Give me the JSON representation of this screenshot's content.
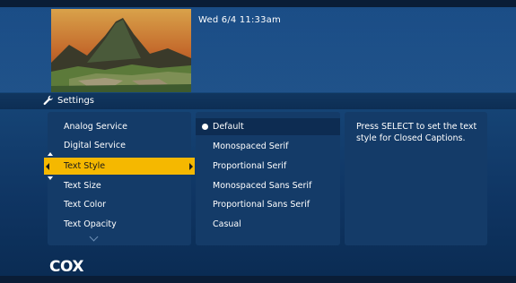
{
  "header": {
    "clock": "Wed 6/4  11:33am",
    "section_title": "Settings"
  },
  "menu": {
    "items": [
      {
        "label": "Analog Service"
      },
      {
        "label": "Digital Service"
      },
      {
        "label": "Text Style"
      },
      {
        "label": "Text Size"
      },
      {
        "label": "Text Color"
      },
      {
        "label": "Text Opacity"
      }
    ],
    "selected": "Text Style"
  },
  "options": {
    "items": [
      {
        "label": "Default"
      },
      {
        "label": "Monospaced Serif"
      },
      {
        "label": "Proportional Serif"
      },
      {
        "label": "Monospaced Sans Serif"
      },
      {
        "label": "Proportional Sans Serif"
      },
      {
        "label": "Casual"
      }
    ],
    "current": "Default"
  },
  "help": {
    "text": "Press SELECT to set the text style for Closed Captions."
  },
  "brand": {
    "logo": "COX",
    "accent": "#f5b800"
  },
  "icons": [
    "wrench-icon",
    "chevron-left-icon",
    "chevron-right-icon",
    "chevron-up-icon",
    "chevron-down-icon",
    "radio-selected-icon"
  ]
}
